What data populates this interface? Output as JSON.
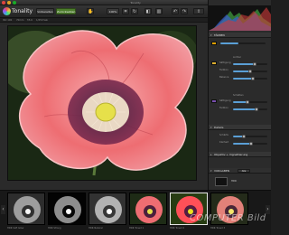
{
  "window": {
    "title": "Tonality"
  },
  "app": {
    "name": "Tonality"
  },
  "toolbar": {
    "buttons": [
      {
        "label": "Vorbereiten"
      },
      {
        "label": "Zurücksetzen"
      },
      {
        "label": "100%"
      },
      {
        "label": "Vergleichen"
      }
    ]
  },
  "infobar": {
    "items": [
      "ISO 100",
      "70mm",
      "f/5.6",
      "1/250 Sek"
    ]
  },
  "panel": {
    "section_color": "FÄRBEN",
    "color_sub": "Lichter",
    "color_sub2": "Schatten",
    "section_details": "Details",
    "section_vignette": "Objektiv + Vignettierung",
    "section_presets": "VORGABEN",
    "preset_tabs": [
      "Alle",
      "HDR"
    ],
    "sliders": [
      {
        "label": "Sättigung",
        "value": 0.62
      },
      {
        "label": "Farbton",
        "value": 0.48
      },
      {
        "label": "Balance",
        "value": 0.55
      },
      {
        "label": "Sättigung",
        "value": 0.4
      },
      {
        "label": "Farbton",
        "value": 0.66
      },
      {
        "label": "Schärfe",
        "value": 0.3
      },
      {
        "label": "Klarheit",
        "value": 0.5
      }
    ]
  },
  "filmstrip": {
    "thumbs": [
      {
        "label": "HDR Soft Glow"
      },
      {
        "label": "HDR Strong"
      },
      {
        "label": "HDR Natural"
      },
      {
        "label": "HDR Toned 1"
      },
      {
        "label": "HDR Toned 2"
      },
      {
        "label": "HDR Toned 3"
      }
    ]
  },
  "watermark": "COMPUTER Bild"
}
